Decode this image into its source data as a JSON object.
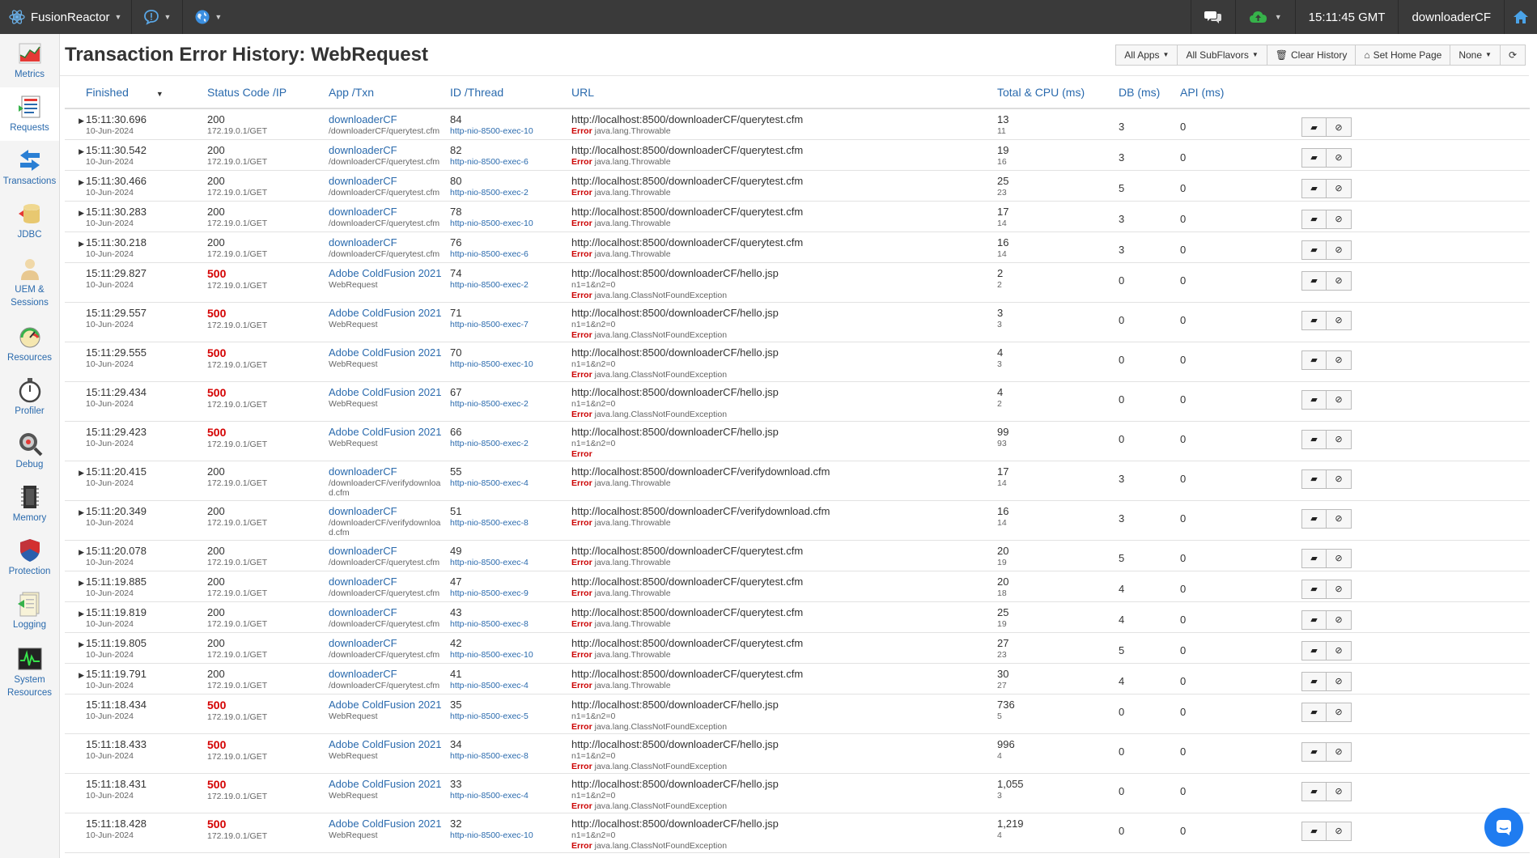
{
  "topbar": {
    "brand": "FusionReactor",
    "time": "15:11:45 GMT",
    "user": "downloaderCF"
  },
  "sidebar": [
    {
      "label": "Metrics",
      "icon": "metrics-icon"
    },
    {
      "label": "Requests",
      "icon": "requests-icon"
    },
    {
      "label": "Transactions",
      "icon": "transactions-icon"
    },
    {
      "label": "JDBC",
      "icon": "jdbc-icon"
    },
    {
      "label": "UEM & Sessions",
      "icon": "uem-icon"
    },
    {
      "label": "Resources",
      "icon": "resources-icon"
    },
    {
      "label": "Profiler",
      "icon": "profiler-icon"
    },
    {
      "label": "Debug",
      "icon": "debug-icon"
    },
    {
      "label": "Memory",
      "icon": "memory-icon"
    },
    {
      "label": "Protection",
      "icon": "protection-icon"
    },
    {
      "label": "Logging",
      "icon": "logging-icon"
    },
    {
      "label": "System Resources",
      "icon": "system-resources-icon"
    }
  ],
  "page": {
    "title": "Transaction Error History: WebRequest",
    "buttons": {
      "all_apps": "All Apps",
      "all_subflavors": "All SubFlavors",
      "clear_history": "Clear History",
      "set_home_page": "Set Home Page",
      "none": "None"
    }
  },
  "table": {
    "headers": {
      "finished": "Finished",
      "status": "Status Code /IP",
      "app": "App /Txn",
      "id": "ID /Thread",
      "url": "URL",
      "total": "Total & CPU (ms)",
      "db": "DB (ms)",
      "api": "API (ms)"
    },
    "rows": [
      {
        "time": "15:11:30.696",
        "date": "10-Jun-2024",
        "code": "200",
        "ip": "172.19.0.1/GET",
        "app": "downloaderCF",
        "txn": "/downloaderCF/querytest.cfm",
        "id": "84",
        "thread": "http-nio-8500-exec-10",
        "url": "http://localhost:8500/downloaderCF/querytest.cfm",
        "query": "",
        "error": "Error",
        "exception": "java.lang.Throwable",
        "total": "13",
        "cpu": "11",
        "db": "3",
        "api": "0",
        "expand": true
      },
      {
        "time": "15:11:30.542",
        "date": "10-Jun-2024",
        "code": "200",
        "ip": "172.19.0.1/GET",
        "app": "downloaderCF",
        "txn": "/downloaderCF/querytest.cfm",
        "id": "82",
        "thread": "http-nio-8500-exec-6",
        "url": "http://localhost:8500/downloaderCF/querytest.cfm",
        "query": "",
        "error": "Error",
        "exception": "java.lang.Throwable",
        "total": "19",
        "cpu": "16",
        "db": "3",
        "api": "0",
        "expand": true
      },
      {
        "time": "15:11:30.466",
        "date": "10-Jun-2024",
        "code": "200",
        "ip": "172.19.0.1/GET",
        "app": "downloaderCF",
        "txn": "/downloaderCF/querytest.cfm",
        "id": "80",
        "thread": "http-nio-8500-exec-2",
        "url": "http://localhost:8500/downloaderCF/querytest.cfm",
        "query": "",
        "error": "Error",
        "exception": "java.lang.Throwable",
        "total": "25",
        "cpu": "23",
        "db": "5",
        "api": "0",
        "expand": true
      },
      {
        "time": "15:11:30.283",
        "date": "10-Jun-2024",
        "code": "200",
        "ip": "172.19.0.1/GET",
        "app": "downloaderCF",
        "txn": "/downloaderCF/querytest.cfm",
        "id": "78",
        "thread": "http-nio-8500-exec-10",
        "url": "http://localhost:8500/downloaderCF/querytest.cfm",
        "query": "",
        "error": "Error",
        "exception": "java.lang.Throwable",
        "total": "17",
        "cpu": "14",
        "db": "3",
        "api": "0",
        "expand": true
      },
      {
        "time": "15:11:30.218",
        "date": "10-Jun-2024",
        "code": "200",
        "ip": "172.19.0.1/GET",
        "app": "downloaderCF",
        "txn": "/downloaderCF/querytest.cfm",
        "id": "76",
        "thread": "http-nio-8500-exec-6",
        "url": "http://localhost:8500/downloaderCF/querytest.cfm",
        "query": "",
        "error": "Error",
        "exception": "java.lang.Throwable",
        "total": "16",
        "cpu": "14",
        "db": "3",
        "api": "0",
        "expand": true
      },
      {
        "time": "15:11:29.827",
        "date": "10-Jun-2024",
        "code": "500",
        "ip": "172.19.0.1/GET",
        "app": "Adobe ColdFusion 2021",
        "txn": "WebRequest",
        "id": "74",
        "thread": "http-nio-8500-exec-2",
        "url": "http://localhost:8500/downloaderCF/hello.jsp",
        "query": "n1=1&n2=0",
        "error": "Error",
        "exception": "java.lang.ClassNotFoundException",
        "total": "2",
        "cpu": "2",
        "db": "0",
        "api": "0",
        "expand": false
      },
      {
        "time": "15:11:29.557",
        "date": "10-Jun-2024",
        "code": "500",
        "ip": "172.19.0.1/GET",
        "app": "Adobe ColdFusion 2021",
        "txn": "WebRequest",
        "id": "71",
        "thread": "http-nio-8500-exec-7",
        "url": "http://localhost:8500/downloaderCF/hello.jsp",
        "query": "n1=1&n2=0",
        "error": "Error",
        "exception": "java.lang.ClassNotFoundException",
        "total": "3",
        "cpu": "3",
        "db": "0",
        "api": "0",
        "expand": false
      },
      {
        "time": "15:11:29.555",
        "date": "10-Jun-2024",
        "code": "500",
        "ip": "172.19.0.1/GET",
        "app": "Adobe ColdFusion 2021",
        "txn": "WebRequest",
        "id": "70",
        "thread": "http-nio-8500-exec-10",
        "url": "http://localhost:8500/downloaderCF/hello.jsp",
        "query": "n1=1&n2=0",
        "error": "Error",
        "exception": "java.lang.ClassNotFoundException",
        "total": "4",
        "cpu": "3",
        "db": "0",
        "api": "0",
        "expand": false
      },
      {
        "time": "15:11:29.434",
        "date": "10-Jun-2024",
        "code": "500",
        "ip": "172.19.0.1/GET",
        "app": "Adobe ColdFusion 2021",
        "txn": "WebRequest",
        "id": "67",
        "thread": "http-nio-8500-exec-2",
        "url": "http://localhost:8500/downloaderCF/hello.jsp",
        "query": "n1=1&n2=0",
        "error": "Error",
        "exception": "java.lang.ClassNotFoundException",
        "total": "4",
        "cpu": "2",
        "db": "0",
        "api": "0",
        "expand": false
      },
      {
        "time": "15:11:29.423",
        "date": "10-Jun-2024",
        "code": "500",
        "ip": "172.19.0.1/GET",
        "app": "Adobe ColdFusion 2021",
        "txn": "WebRequest",
        "id": "66",
        "thread": "http-nio-8500-exec-2",
        "url": "http://localhost:8500/downloaderCF/hello.jsp",
        "query": "n1=1&n2=0",
        "error": "Error",
        "exception": "",
        "total": "99",
        "cpu": "93",
        "db": "0",
        "api": "0",
        "expand": false
      },
      {
        "time": "15:11:20.415",
        "date": "10-Jun-2024",
        "code": "200",
        "ip": "172.19.0.1/GET",
        "app": "downloaderCF",
        "txn": "/downloaderCF/verifydownloa d.cfm",
        "id": "55",
        "thread": "http-nio-8500-exec-4",
        "url": "http://localhost:8500/downloaderCF/verifydownload.cfm",
        "query": "",
        "error": "Error",
        "exception": "java.lang.Throwable",
        "total": "17",
        "cpu": "14",
        "db": "3",
        "api": "0",
        "expand": true
      },
      {
        "time": "15:11:20.349",
        "date": "10-Jun-2024",
        "code": "200",
        "ip": "172.19.0.1/GET",
        "app": "downloaderCF",
        "txn": "/downloaderCF/verifydownloa d.cfm",
        "id": "51",
        "thread": "http-nio-8500-exec-8",
        "url": "http://localhost:8500/downloaderCF/verifydownload.cfm",
        "query": "",
        "error": "Error",
        "exception": "java.lang.Throwable",
        "total": "16",
        "cpu": "14",
        "db": "3",
        "api": "0",
        "expand": true
      },
      {
        "time": "15:11:20.078",
        "date": "10-Jun-2024",
        "code": "200",
        "ip": "172.19.0.1/GET",
        "app": "downloaderCF",
        "txn": "/downloaderCF/querytest.cfm",
        "id": "49",
        "thread": "http-nio-8500-exec-4",
        "url": "http://localhost:8500/downloaderCF/querytest.cfm",
        "query": "",
        "error": "Error",
        "exception": "java.lang.Throwable",
        "total": "20",
        "cpu": "19",
        "db": "5",
        "api": "0",
        "expand": true
      },
      {
        "time": "15:11:19.885",
        "date": "10-Jun-2024",
        "code": "200",
        "ip": "172.19.0.1/GET",
        "app": "downloaderCF",
        "txn": "/downloaderCF/querytest.cfm",
        "id": "47",
        "thread": "http-nio-8500-exec-9",
        "url": "http://localhost:8500/downloaderCF/querytest.cfm",
        "query": "",
        "error": "Error",
        "exception": "java.lang.Throwable",
        "total": "20",
        "cpu": "18",
        "db": "4",
        "api": "0",
        "expand": true
      },
      {
        "time": "15:11:19.819",
        "date": "10-Jun-2024",
        "code": "200",
        "ip": "172.19.0.1/GET",
        "app": "downloaderCF",
        "txn": "/downloaderCF/querytest.cfm",
        "id": "43",
        "thread": "http-nio-8500-exec-8",
        "url": "http://localhost:8500/downloaderCF/querytest.cfm",
        "query": "",
        "error": "Error",
        "exception": "java.lang.Throwable",
        "total": "25",
        "cpu": "19",
        "db": "4",
        "api": "0",
        "expand": true
      },
      {
        "time": "15:11:19.805",
        "date": "10-Jun-2024",
        "code": "200",
        "ip": "172.19.0.1/GET",
        "app": "downloaderCF",
        "txn": "/downloaderCF/querytest.cfm",
        "id": "42",
        "thread": "http-nio-8500-exec-10",
        "url": "http://localhost:8500/downloaderCF/querytest.cfm",
        "query": "",
        "error": "Error",
        "exception": "java.lang.Throwable",
        "total": "27",
        "cpu": "23",
        "db": "5",
        "api": "0",
        "expand": true
      },
      {
        "time": "15:11:19.791",
        "date": "10-Jun-2024",
        "code": "200",
        "ip": "172.19.0.1/GET",
        "app": "downloaderCF",
        "txn": "/downloaderCF/querytest.cfm",
        "id": "41",
        "thread": "http-nio-8500-exec-4",
        "url": "http://localhost:8500/downloaderCF/querytest.cfm",
        "query": "",
        "error": "Error",
        "exception": "java.lang.Throwable",
        "total": "30",
        "cpu": "27",
        "db": "4",
        "api": "0",
        "expand": true
      },
      {
        "time": "15:11:18.434",
        "date": "10-Jun-2024",
        "code": "500",
        "ip": "172.19.0.1/GET",
        "app": "Adobe ColdFusion 2021",
        "txn": "WebRequest",
        "id": "35",
        "thread": "http-nio-8500-exec-5",
        "url": "http://localhost:8500/downloaderCF/hello.jsp",
        "query": "n1=1&n2=0",
        "error": "Error",
        "exception": "java.lang.ClassNotFoundException",
        "total": "736",
        "cpu": "5",
        "db": "0",
        "api": "0",
        "expand": false
      },
      {
        "time": "15:11:18.433",
        "date": "10-Jun-2024",
        "code": "500",
        "ip": "172.19.0.1/GET",
        "app": "Adobe ColdFusion 2021",
        "txn": "WebRequest",
        "id": "34",
        "thread": "http-nio-8500-exec-8",
        "url": "http://localhost:8500/downloaderCF/hello.jsp",
        "query": "n1=1&n2=0",
        "error": "Error",
        "exception": "java.lang.ClassNotFoundException",
        "total": "996",
        "cpu": "4",
        "db": "0",
        "api": "0",
        "expand": false
      },
      {
        "time": "15:11:18.431",
        "date": "10-Jun-2024",
        "code": "500",
        "ip": "172.19.0.1/GET",
        "app": "Adobe ColdFusion 2021",
        "txn": "WebRequest",
        "id": "33",
        "thread": "http-nio-8500-exec-4",
        "url": "http://localhost:8500/downloaderCF/hello.jsp",
        "query": "n1=1&n2=0",
        "error": "Error",
        "exception": "java.lang.ClassNotFoundException",
        "total": "1,055",
        "cpu": "3",
        "db": "0",
        "api": "0",
        "expand": false
      },
      {
        "time": "15:11:18.428",
        "date": "10-Jun-2024",
        "code": "500",
        "ip": "172.19.0.1/GET",
        "app": "Adobe ColdFusion 2021",
        "txn": "WebRequest",
        "id": "32",
        "thread": "http-nio-8500-exec-10",
        "url": "http://localhost:8500/downloaderCF/hello.jsp",
        "query": "n1=1&n2=0",
        "error": "Error",
        "exception": "java.lang.ClassNotFoundException",
        "total": "1,219",
        "cpu": "4",
        "db": "0",
        "api": "0",
        "expand": false
      }
    ]
  }
}
